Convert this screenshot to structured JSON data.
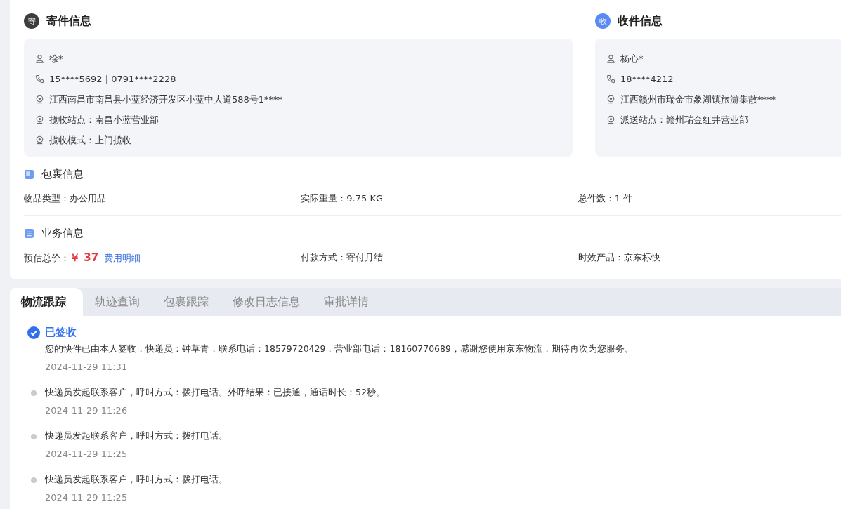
{
  "sender": {
    "badge": "寄",
    "title": "寄件信息",
    "rows": [
      {
        "kind": "person",
        "text": "徐*"
      },
      {
        "kind": "phone",
        "text": "15****5692 | 0791****2228"
      },
      {
        "kind": "location",
        "text": "江西南昌市南昌县小蓝经济开发区小蓝中大道588号1****"
      },
      {
        "kind": "location",
        "text": "揽收站点：南昌小蓝营业部"
      },
      {
        "kind": "location",
        "text": "揽收模式：上门揽收"
      }
    ]
  },
  "receiver": {
    "badge": "收",
    "title": "收件信息",
    "rows": [
      {
        "kind": "person",
        "text": "杨心*"
      },
      {
        "kind": "phone",
        "text": "18****4212"
      },
      {
        "kind": "location",
        "text": "江西赣州市瑞金市象湖镇旅游集散****"
      },
      {
        "kind": "location",
        "text": "派送站点：赣州瑞金红井营业部"
      }
    ]
  },
  "package": {
    "title": "包裹信息",
    "fields": [
      {
        "label": "物品类型：",
        "value": "办公用品"
      },
      {
        "label": "实际重量：",
        "value": "9.75 KG"
      },
      {
        "label": "总件数：",
        "value": "1 件"
      }
    ]
  },
  "business": {
    "title": "业务信息",
    "fields": [
      {
        "kind": "price",
        "label": "预估总价：",
        "value": "￥ 37",
        "link": "费用明细"
      },
      {
        "kind": "text",
        "label": "付款方式：",
        "value": "寄付月结"
      },
      {
        "kind": "text",
        "label": "时效产品：",
        "value": "京东标快"
      }
    ]
  },
  "tabs": [
    {
      "label": "物流跟踪",
      "selected": true
    },
    {
      "label": "轨迹查询",
      "selected": false
    },
    {
      "label": "包裹跟踪",
      "selected": false
    },
    {
      "label": "修改日志信息",
      "selected": false
    },
    {
      "label": "审批详情",
      "selected": false
    }
  ],
  "timeline": [
    {
      "kind": "signed",
      "status": "已签收",
      "text": "您的快件已由本人签收，快递员：钟草青，联系电话：18579720429，营业部电话：18160770689，感谢您使用京东物流，期待再次为您服务。",
      "time": "2024-11-29 11:31"
    },
    {
      "kind": "step",
      "text": "快递员发起联系客户，呼叫方式：拨打电话。外呼结果：已接通，通话时长：52秒。",
      "time": "2024-11-29 11:26"
    },
    {
      "kind": "step",
      "text": "快递员发起联系客户，呼叫方式：拨打电话。",
      "time": "2024-11-29 11:25"
    },
    {
      "kind": "step",
      "text": "快递员发起联系客户，呼叫方式：拨打电话。",
      "time": "2024-11-29 11:25"
    }
  ]
}
